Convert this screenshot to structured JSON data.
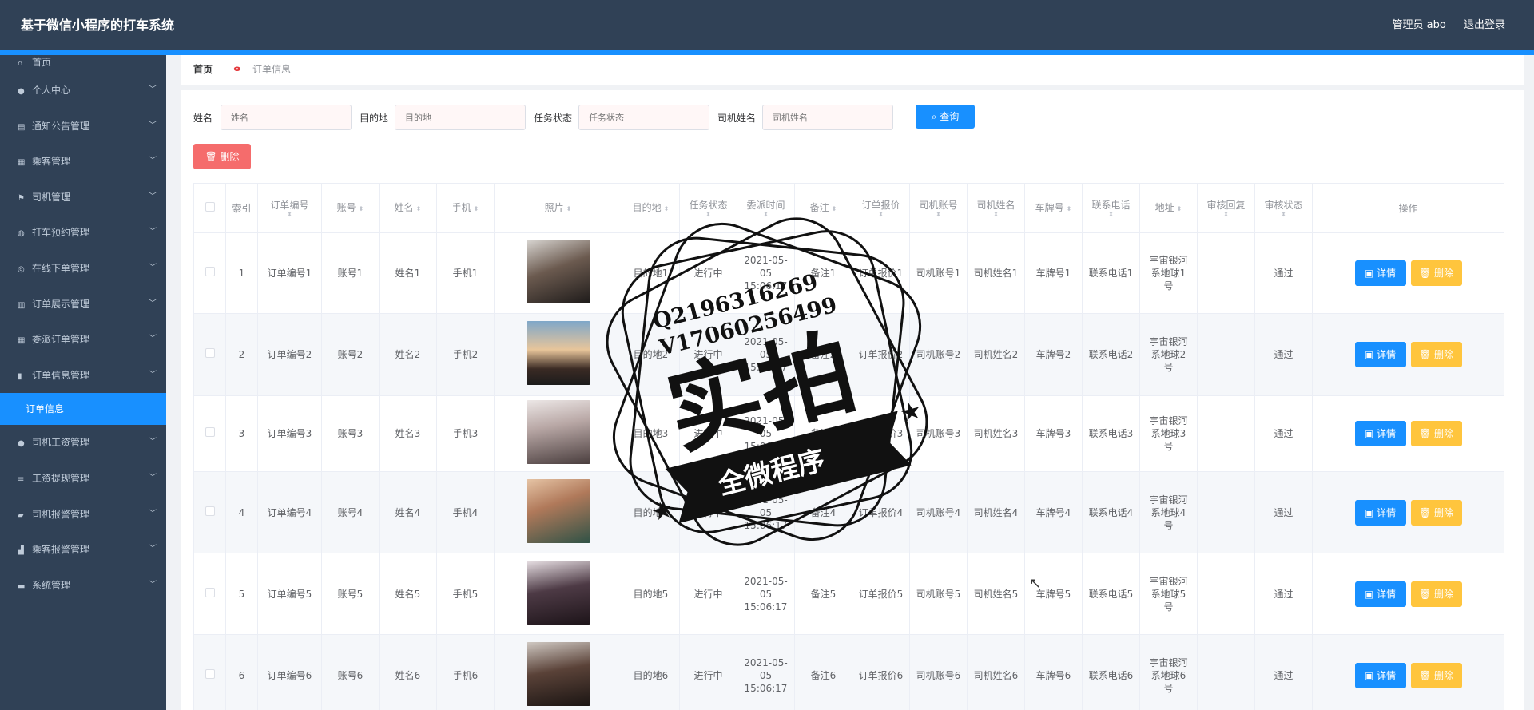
{
  "app": {
    "title": "基于微信小程序的打车系统",
    "user": "管理员 abo",
    "logout": "退出登录"
  },
  "sidebar": {
    "items": [
      {
        "label": "首页",
        "icon": "home-icon",
        "glyph": "⌂"
      },
      {
        "label": "个人中心",
        "icon": "user-icon",
        "glyph": "●"
      },
      {
        "label": "通知公告管理",
        "icon": "notice-icon",
        "glyph": "▤"
      },
      {
        "label": "乘客管理",
        "icon": "passenger-icon",
        "glyph": "▦"
      },
      {
        "label": "司机管理",
        "icon": "flag-icon",
        "glyph": "⚑"
      },
      {
        "label": "打车预约管理",
        "icon": "reserve-icon",
        "glyph": "◍"
      },
      {
        "label": "在线下单管理",
        "icon": "order-online-icon",
        "glyph": "◎"
      },
      {
        "label": "订单展示管理",
        "icon": "chart-icon",
        "glyph": "▥"
      },
      {
        "label": "委派订单管理",
        "icon": "grid-icon",
        "glyph": "▦"
      },
      {
        "label": "订单信息管理",
        "icon": "document-icon",
        "glyph": "▮"
      },
      {
        "label": "司机工资管理",
        "icon": "wage-icon",
        "glyph": "●"
      },
      {
        "label": "工资提现管理",
        "icon": "withdraw-icon",
        "glyph": "≡"
      },
      {
        "label": "司机报警管理",
        "icon": "alarm-icon",
        "glyph": "▰"
      },
      {
        "label": "乘客报警管理",
        "icon": "passenger-alarm-icon",
        "glyph": "▟"
      },
      {
        "label": "系统管理",
        "icon": "system-icon",
        "glyph": "▬"
      }
    ],
    "active_sub": "订单信息"
  },
  "breadcrumb": {
    "home": "首页",
    "current": "订单信息"
  },
  "search": {
    "name_label": "姓名",
    "name_placeholder": "姓名",
    "dest_label": "目的地",
    "dest_placeholder": "目的地",
    "status_label": "任务状态",
    "status_placeholder": "任务状态",
    "driver_label": "司机姓名",
    "driver_placeholder": "司机姓名",
    "query": "查询"
  },
  "toolbar": {
    "delete": "删除"
  },
  "table": {
    "headers": [
      "索引",
      "订单编号",
      "账号",
      "姓名",
      "手机",
      "照片",
      "目的地",
      "任务状态",
      "委派时间",
      "备注",
      "订单报价",
      "司机账号",
      "司机姓名",
      "车牌号",
      "联系电话",
      "地址",
      "审核回复",
      "审核状态",
      "操作"
    ],
    "rows": [
      [
        "1",
        "订单编号1",
        "账号1",
        "姓名1",
        "手机1",
        "",
        "目的地1",
        "进行中",
        "2021-05-05 15:06:17",
        "备注1",
        "订单报价1",
        "司机账号1",
        "司机姓名1",
        "车牌号1",
        "联系电话1",
        "宇宙银河系地球1号",
        "",
        "通过"
      ],
      [
        "2",
        "订单编号2",
        "账号2",
        "姓名2",
        "手机2",
        "",
        "目的地2",
        "进行中",
        "2021-05-05 15:06:17",
        "备注2",
        "订单报价2",
        "司机账号2",
        "司机姓名2",
        "车牌号2",
        "联系电话2",
        "宇宙银河系地球2号",
        "",
        "通过"
      ],
      [
        "3",
        "订单编号3",
        "账号3",
        "姓名3",
        "手机3",
        "",
        "目的地3",
        "进行中",
        "2021-05-05 15:06:17",
        "备注3",
        "订单报价3",
        "司机账号3",
        "司机姓名3",
        "车牌号3",
        "联系电话3",
        "宇宙银河系地球3号",
        "",
        "通过"
      ],
      [
        "4",
        "订单编号4",
        "账号4",
        "姓名4",
        "手机4",
        "",
        "目的地4",
        "进行中",
        "2021-05-05 15:06:17",
        "备注4",
        "订单报价4",
        "司机账号4",
        "司机姓名4",
        "车牌号4",
        "联系电话4",
        "宇宙银河系地球4号",
        "",
        "通过"
      ],
      [
        "5",
        "订单编号5",
        "账号5",
        "姓名5",
        "手机5",
        "",
        "目的地5",
        "进行中",
        "2021-05-05 15:06:17",
        "备注5",
        "订单报价5",
        "司机账号5",
        "司机姓名5",
        "车牌号5",
        "联系电话5",
        "宇宙银河系地球5号",
        "",
        "通过"
      ],
      [
        "6",
        "订单编号6",
        "账号6",
        "姓名6",
        "手机6",
        "",
        "目的地6",
        "进行中",
        "2021-05-05 15:06:17",
        "备注6",
        "订单报价6",
        "司机账号6",
        "司机姓名6",
        "车牌号6",
        "联系电话6",
        "宇宙银河系地球6号",
        "",
        "通过"
      ]
    ],
    "detail": "详情",
    "delete": "删除"
  },
  "watermark": {
    "qq": "Q2196316269",
    "wechat": "V17060256499",
    "main": "实拍",
    "banner": "全微程序"
  },
  "colors": {
    "header_bg": "#304156",
    "accent": "#1890ff",
    "danger": "#f56c6c",
    "warning": "#ffc53d"
  }
}
